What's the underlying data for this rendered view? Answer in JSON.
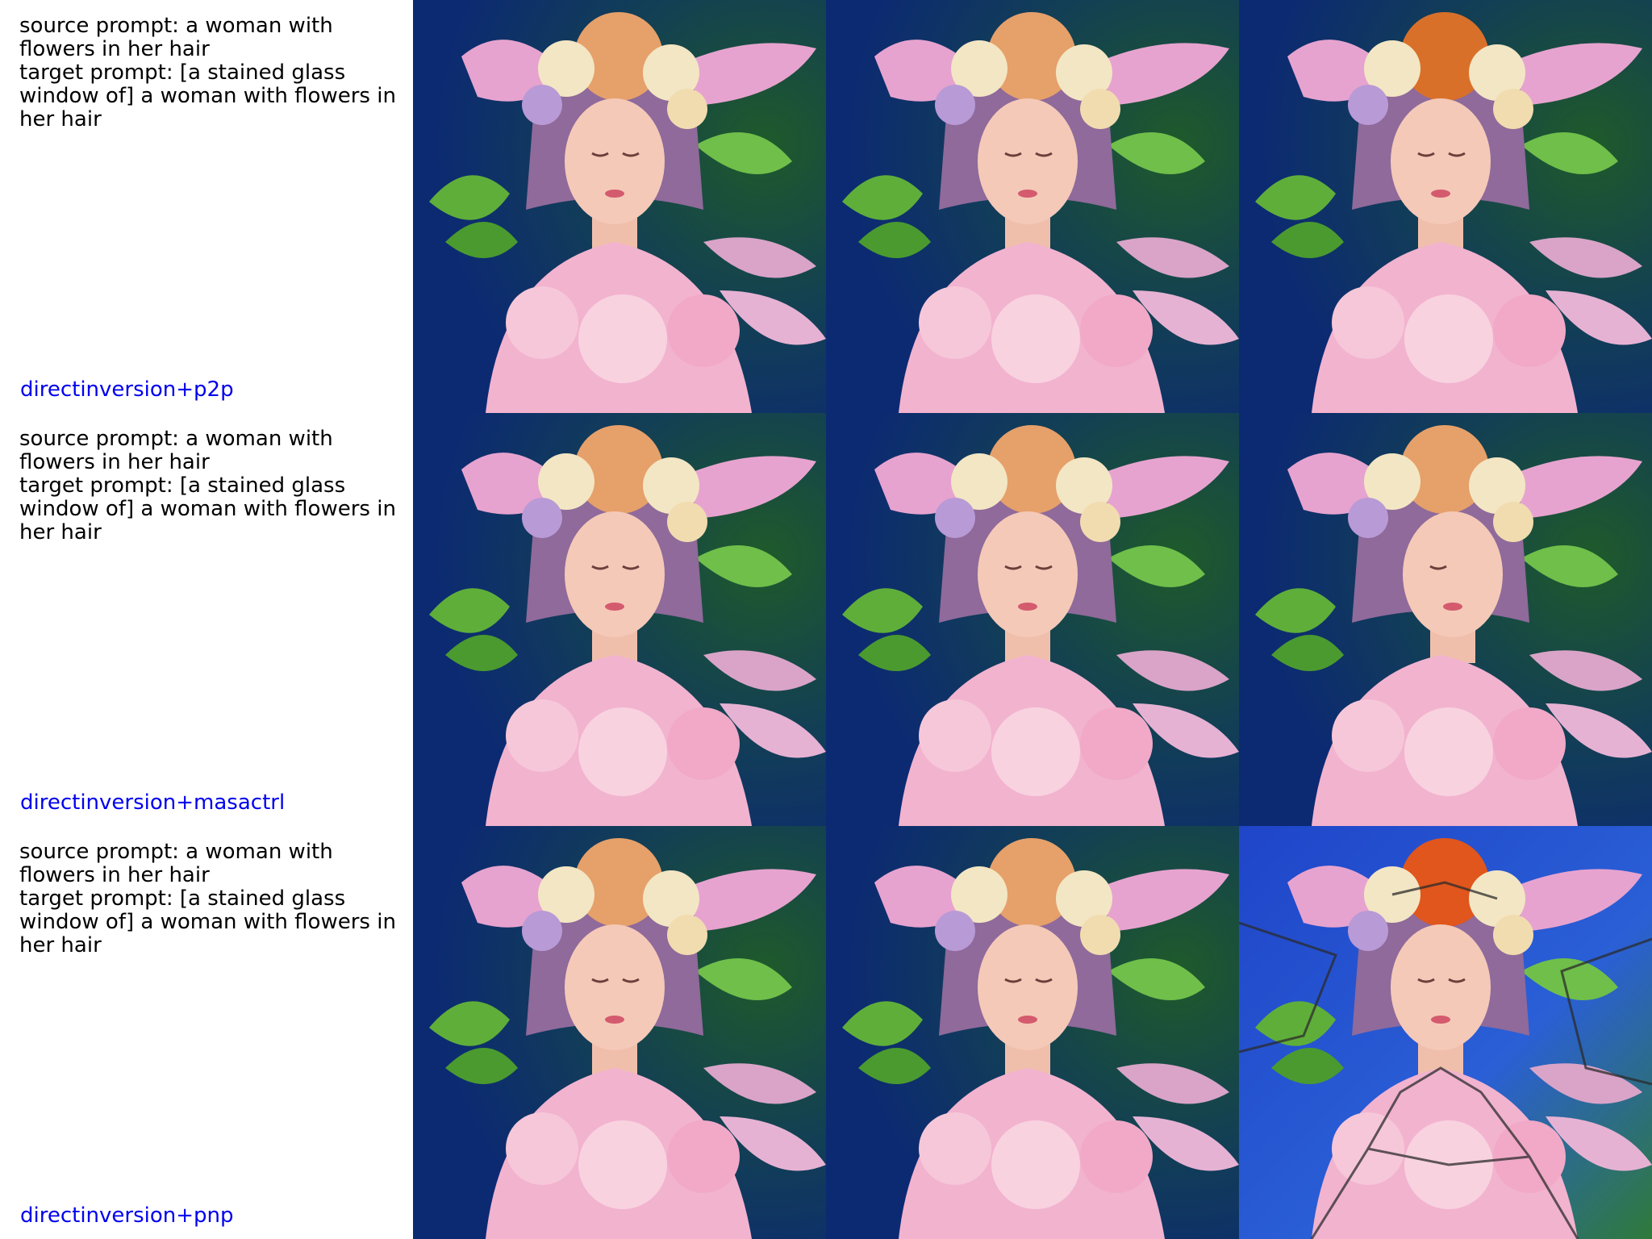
{
  "rows": [
    {
      "source_prompt": "source prompt: a woman with flowers in her hair",
      "target_prompt": "target prompt: [a stained glass window of] a woman with flowers in her hair",
      "method": "directinversion+p2p",
      "images": [
        {
          "style": "painting",
          "label": "woman with flowers in her hair (source)"
        },
        {
          "style": "painting",
          "label": "woman with flowers in her hair (reconstruction)"
        },
        {
          "style": "painting-edited",
          "label": "woman with flowers in her hair (edited)"
        }
      ]
    },
    {
      "source_prompt": "source prompt: a woman with flowers in her hair",
      "target_prompt": "target prompt: [a stained glass window of] a woman with flowers in her hair",
      "method": "directinversion+masactrl",
      "images": [
        {
          "style": "painting",
          "label": "woman with flowers in her hair (source)"
        },
        {
          "style": "painting",
          "label": "woman with flowers in her hair (reconstruction)"
        },
        {
          "style": "painting-profile",
          "label": "woman with flowers in her hair (edited)"
        }
      ]
    },
    {
      "source_prompt": "source prompt: a woman with flowers in her hair",
      "target_prompt": "target prompt: [a stained glass window of] a woman with flowers in her hair",
      "method": "directinversion+pnp",
      "images": [
        {
          "style": "painting",
          "label": "woman with flowers in her hair (source)"
        },
        {
          "style": "painting",
          "label": "woman with flowers in her hair (reconstruction)"
        },
        {
          "style": "stained-glass",
          "label": "woman with flowers in her hair (edited)"
        }
      ]
    }
  ],
  "colors": {
    "text": "#000000",
    "method": "#0000ee",
    "bg_blue": "#0e2f7a",
    "bg_green": "#1f5a2a",
    "skin": "#f4c9b8",
    "dress": "#f2b3cf",
    "hair": "#8f6a9a"
  }
}
